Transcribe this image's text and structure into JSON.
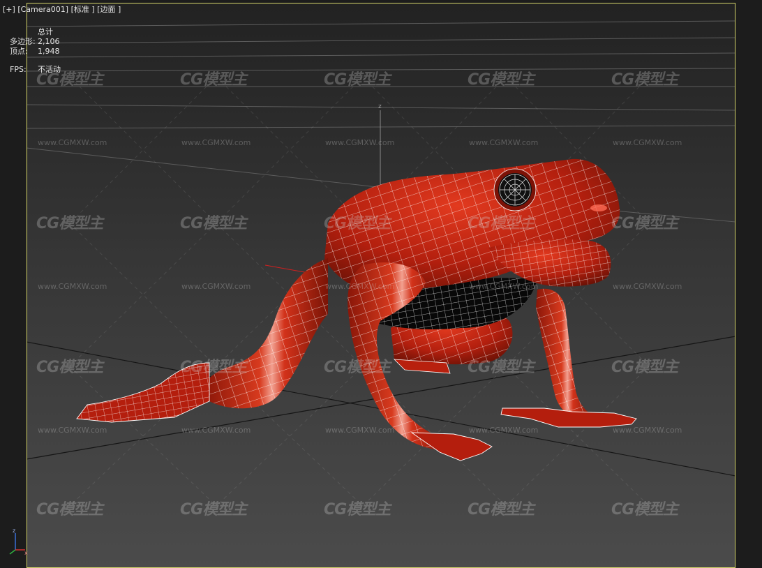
{
  "viewport": {
    "menu": {
      "plus": "[+]",
      "camera": "[Camera001]",
      "shading": "[标准 ]",
      "edges": "[边面 ]"
    },
    "stats": {
      "header": "总计",
      "polys_label": "多边形:",
      "polys_value": "2,106",
      "verts_label": "顶点:",
      "verts_value": "1,948",
      "fps_label": "FPS:",
      "fps_value": "不活动"
    },
    "axis_labels": {
      "z": "z",
      "x": "x"
    },
    "watermark": {
      "logo": "CG模型主",
      "url": "www.CGMXW.com"
    },
    "colors": {
      "viewport_bg_top": "#222222",
      "viewport_bg_bottom": "#4a4a4a",
      "active_border": "#d5d56a",
      "model_red": "#c2220f",
      "wire": "#ffffff",
      "text": "#e6e6e6"
    },
    "icons": [
      "axis-gizmo-icon"
    ]
  }
}
